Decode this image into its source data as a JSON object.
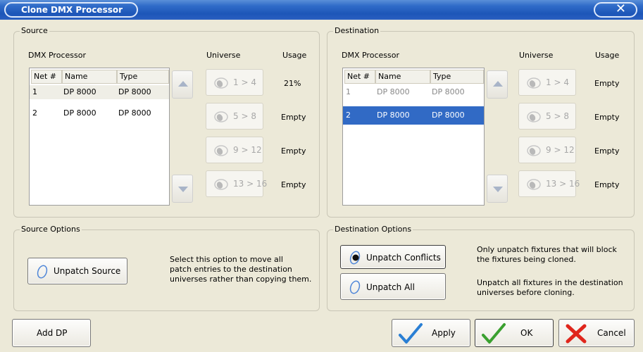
{
  "window": {
    "title": "Clone DMX Processor",
    "close_glyph": "✕"
  },
  "source": {
    "group_title": "Source",
    "col_dmx": "DMX Processor",
    "col_universe": "Universe",
    "col_usage": "Usage",
    "headers": [
      "Net #",
      "Name",
      "Type"
    ],
    "rows": [
      {
        "net": "1",
        "name": "DP 8000",
        "type": "DP 8000"
      },
      {
        "net": "2",
        "name": "DP 8000",
        "type": "DP 8000"
      }
    ],
    "universes": [
      {
        "label": "1 > 4",
        "usage": "21%"
      },
      {
        "label": "5 > 8",
        "usage": "Empty"
      },
      {
        "label": "9 > 12",
        "usage": "Empty"
      },
      {
        "label": "13 > 16",
        "usage": "Empty"
      }
    ]
  },
  "destination": {
    "group_title": "Destination",
    "col_dmx": "DMX Processor",
    "col_universe": "Universe",
    "col_usage": "Usage",
    "headers": [
      "Net #",
      "Name",
      "Type"
    ],
    "rows": [
      {
        "net": "1",
        "name": "DP 8000",
        "type": "DP 8000"
      },
      {
        "net": "2",
        "name": "DP 8000",
        "type": "DP 8000"
      }
    ],
    "universes": [
      {
        "label": "1 > 4",
        "usage": "Empty"
      },
      {
        "label": "5 > 8",
        "usage": "Empty"
      },
      {
        "label": "9 > 12",
        "usage": "Empty"
      },
      {
        "label": "13 > 16",
        "usage": "Empty"
      }
    ]
  },
  "source_options": {
    "group_title": "Source Options",
    "unpatch_source_label": "Unpatch Source",
    "description_lines": [
      "Select this option to move all",
      "patch entries to the destination",
      "universes rather than copying them."
    ]
  },
  "destination_options": {
    "group_title": "Destination Options",
    "unpatch_conflicts_label": "Unpatch Conflicts",
    "unpatch_conflicts_desc_lines": [
      "Only unpatch fixtures that will block",
      "the fixtures being cloned."
    ],
    "unpatch_all_label": "Unpatch All",
    "unpatch_all_desc_lines": [
      "Unpatch all fixtures in the destination",
      "universes before cloning."
    ]
  },
  "footer": {
    "add_dp_label": "Add DP",
    "apply_label": "Apply",
    "ok_label": "OK",
    "cancel_label": "Cancel"
  },
  "colors": {
    "title_bar": "#2f6bc8",
    "selection": "#316ac5",
    "check_blue": "#2a7fd4",
    "check_green": "#3aa02f",
    "cancel_red": "#e0261c",
    "face": "#ece9d8"
  },
  "icons": {
    "radio_off": "radio-off-icon",
    "radio_on": "radio-on-icon",
    "univ": "universe-icon"
  }
}
